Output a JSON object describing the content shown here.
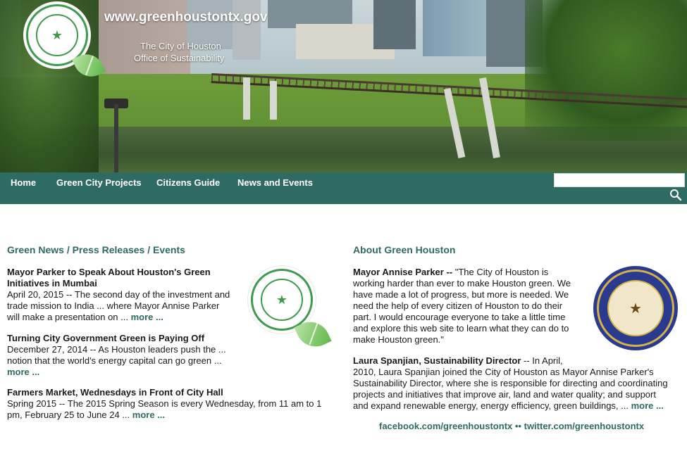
{
  "banner": {
    "site_url": "www.greenhoustontx.gov",
    "office_line1": "The City of Houston",
    "office_line2": "Office of Sustainability"
  },
  "nav": {
    "items": [
      {
        "label": "Home"
      },
      {
        "label": "Green City Projects"
      },
      {
        "label": "Citizens Guide"
      },
      {
        "label": "News and Events"
      }
    ],
    "search_value": "",
    "search_icon": "magnifier-icon"
  },
  "news": {
    "heading": "Green News / Press Releases / Events",
    "items": [
      {
        "title": "Mayor Parker to Speak About Houston's Green Initiatives in Mumbai",
        "body_line1": "April 20, 2015 -- The second day of the investment and",
        "body_line2": "trade mission to India ... where Mayor Annise Parker",
        "body_line3": "will make a presentation on ...",
        "more": "more ..."
      },
      {
        "title": "Turning City Government Green is Paying Off",
        "body_line1": "December 27, 2014 -- As Houston leaders push the ...",
        "body_line2": "notion that the world's energy capital can go green ...",
        "more": "more ..."
      },
      {
        "title": "Farmers Market, Wednesdays in Front of City Hall",
        "body_line1": "Spring 2015 -- The 2015 Spring Season is every Wednesday, from 11 am to 1",
        "body_line2": "pm, February 25 to June 24 ...",
        "more": "more ..."
      }
    ]
  },
  "about": {
    "heading": "About Green Houston",
    "mayor": {
      "name": "Mayor Annise Parker --",
      "quote_lines": [
        "\"The City of Houston is",
        "working harder than ever to make Houston green. We",
        "have made a lot of progress, but more is needed. We",
        "need the help of every citizen of Houston to do their",
        "part. I would encourage everyone to take a little time",
        "and explore this web site to learn what they can do to",
        "make Houston green.\""
      ]
    },
    "director": {
      "name": "Laura Spanjian, Sustainability Director",
      "lines": [
        " -- In April,",
        "2010, Laura Spanjian joined the City of Houston as Mayor Annise Parker's",
        "Sustainability Director, where she is responsible for directing and coordinating",
        "projects and initiatives that improve air, land and water quality; and support",
        "and expand renewable energy, energy efficiency, green buildings, ..."
      ],
      "more": "more ..."
    },
    "social": {
      "facebook": "facebook.com/greenhoustontx",
      "separator": "••",
      "twitter": "twitter.com/greenhoustontx"
    }
  },
  "colors": {
    "nav_bg": "#2e6b62",
    "heading": "#2e6b62",
    "seal_green": "#3f9a4f",
    "seal_blue": "#2a3a8e"
  }
}
